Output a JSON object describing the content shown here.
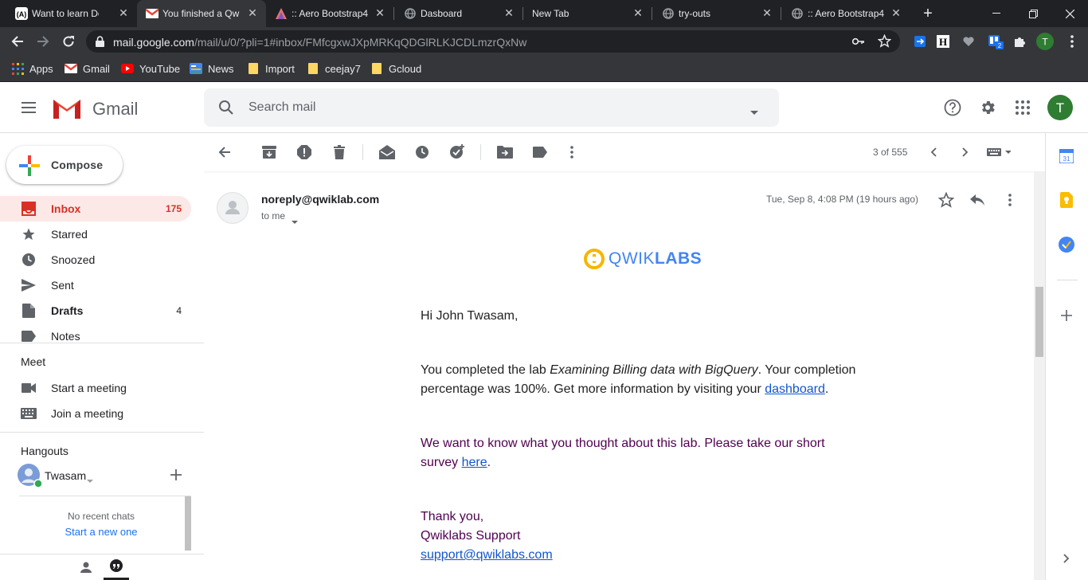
{
  "browser": {
    "tabs": [
      {
        "title": "Want to learn Dev",
        "favicon": "devto-icon"
      },
      {
        "title": "You finished a Qw",
        "favicon": "gmail-icon",
        "active": true
      },
      {
        "title": ":: Aero Bootstrap4",
        "favicon": "aero-icon"
      },
      {
        "title": "Dasboard",
        "favicon": "globe-icon"
      },
      {
        "title": "New Tab",
        "favicon": ""
      },
      {
        "title": "try-outs",
        "favicon": "globe-icon"
      },
      {
        "title": ":: Aero Bootstrap4",
        "favicon": "globe-icon"
      }
    ],
    "url_host": "mail.google.com",
    "url_path": "/mail/u/0/?pli=1#inbox/FMfcgxwJXpMRKqQDGlRLKJCDLmzrQxNw",
    "profile_initial": "T",
    "extension_badge": "2",
    "bookmarks": [
      {
        "label": "Apps",
        "icon": "apps-grid-icon"
      },
      {
        "label": "Gmail",
        "icon": "gmail-icon"
      },
      {
        "label": "YouTube",
        "icon": "youtube-icon"
      },
      {
        "label": "News",
        "icon": "news-icon"
      },
      {
        "label": "Import",
        "icon": "folder-icon"
      },
      {
        "label": "ceejay7",
        "icon": "folder-icon"
      },
      {
        "label": "Gcloud",
        "icon": "folder-icon"
      }
    ]
  },
  "gmail": {
    "logo_text": "Gmail",
    "search_placeholder": "Search mail",
    "account_initial": "T",
    "compose_label": "Compose",
    "nav": [
      {
        "label": "Inbox",
        "count": "175",
        "icon": "inbox-icon",
        "active": true
      },
      {
        "label": "Starred",
        "count": "",
        "icon": "star-icon"
      },
      {
        "label": "Snoozed",
        "count": "",
        "icon": "clock-icon"
      },
      {
        "label": "Sent",
        "count": "",
        "icon": "send-icon"
      },
      {
        "label": "Drafts",
        "count": "4",
        "icon": "draft-icon"
      },
      {
        "label": "Notes",
        "count": "",
        "icon": "label-icon"
      }
    ],
    "meet": {
      "title": "Meet",
      "items": [
        {
          "label": "Start a meeting",
          "icon": "video-icon"
        },
        {
          "label": "Join a meeting",
          "icon": "keyboard-icon"
        }
      ]
    },
    "hangouts": {
      "title": "Hangouts",
      "user": "Twasam",
      "no_chats": "No recent chats",
      "start_new": "Start a new one"
    },
    "pagination": "3 of 555",
    "email": {
      "sender": "noreply@qwiklab.com",
      "to": "to me",
      "date": "Tue, Sep 8, 4:08 PM (19 hours ago)",
      "brand_part1": "QWIK",
      "brand_part2": "LABS",
      "greeting": "Hi John Twasam,",
      "p1_before": "You completed the lab ",
      "p1_lab": "Examining Billing data with BigQuery",
      "p1_after": ". Your completion",
      "p1_line2": "percentage was 100%. Get more information by visiting your ",
      "p1_link": "dashboard",
      "p1_end": ".",
      "p2_line1": "We want to know what you thought about this lab. Please take our short",
      "p2_line2": "survey ",
      "p2_link": "here",
      "p2_end": ".",
      "thanks": "Thank you,",
      "signoff": "Qwiklabs Support",
      "support_email": "support@qwiklabs.com"
    }
  },
  "colors": {
    "chrome_dark": "#202124",
    "chrome_toolbar": "#35363a",
    "gmail_red": "#d93025",
    "inbox_bg": "#fce8e6",
    "link": "#1155cc",
    "profile_green": "#2e7d32"
  }
}
